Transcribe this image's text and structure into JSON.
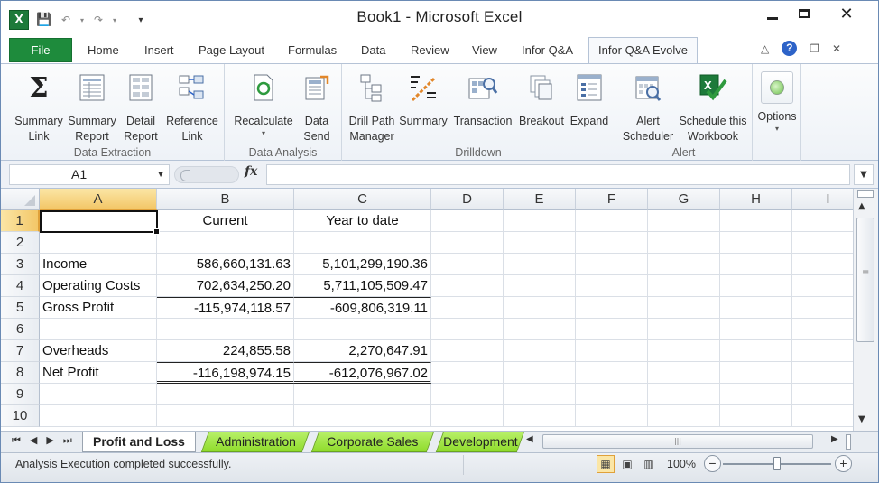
{
  "window": {
    "title": "Book1  -  Microsoft Excel",
    "app_icon_letter": "X"
  },
  "ribbon_tabs": [
    "File",
    "Home",
    "Insert",
    "Page Layout",
    "Formulas",
    "Data",
    "Review",
    "View",
    "Infor Q&A",
    "Infor Q&A Evolve"
  ],
  "active_tab": "Infor Q&A Evolve",
  "ribbon_groups": [
    {
      "label": "Data Extraction",
      "buttons": [
        {
          "line1": "Summary",
          "line2": "Link",
          "icon": "sigma-icon"
        },
        {
          "line1": "Summary",
          "line2": "Report",
          "icon": "summary-report-icon"
        },
        {
          "line1": "Detail",
          "line2": "Report",
          "icon": "detail-report-icon"
        },
        {
          "line1": "Reference",
          "line2": "Link",
          "icon": "reference-link-icon"
        }
      ]
    },
    {
      "label": "Data Analysis",
      "buttons": [
        {
          "line1": "Recalculate",
          "line2": "",
          "icon": "recalculate-icon"
        },
        {
          "line1": "Data",
          "line2": "Send",
          "icon": "data-send-icon"
        }
      ]
    },
    {
      "label": "Drilldown",
      "buttons": [
        {
          "line1": "Drill Path",
          "line2": "Manager",
          "icon": "drill-path-icon"
        },
        {
          "line1": "Summary",
          "line2": "",
          "icon": "drill-summary-icon"
        },
        {
          "line1": "Transaction",
          "line2": "",
          "icon": "transaction-icon"
        },
        {
          "line1": "Breakout",
          "line2": "",
          "icon": "breakout-icon"
        },
        {
          "line1": "Expand",
          "line2": "",
          "icon": "expand-icon"
        }
      ]
    },
    {
      "label": "Alert",
      "buttons": [
        {
          "line1": "Alert",
          "line2": "Scheduler",
          "icon": "alert-scheduler-icon"
        },
        {
          "line1": "Schedule this",
          "line2": "Workbook",
          "icon": "schedule-workbook-icon"
        }
      ]
    },
    {
      "label": "",
      "buttons": [
        {
          "line1": "Options",
          "line2": "",
          "icon": "options-icon"
        }
      ]
    }
  ],
  "formula_bar": {
    "name_box": "A1",
    "fx": "fx",
    "formula": ""
  },
  "columns": [
    "A",
    "B",
    "C",
    "D",
    "E",
    "F",
    "G",
    "H",
    "I"
  ],
  "rows": [
    "1",
    "2",
    "3",
    "4",
    "5",
    "6",
    "7",
    "8",
    "9",
    "10"
  ],
  "cells": {
    "B1": "Current",
    "C1": "Year to date",
    "A3": "Income",
    "B3": "586,660,131.63",
    "C3": "5,101,299,190.36",
    "A4": "Operating Costs",
    "B4": "702,634,250.20",
    "C4": "5,711,105,509.47",
    "A5": "Gross Profit",
    "B5": "-115,974,118.57",
    "C5": "-609,806,319.11",
    "A7": "Overheads",
    "B7": "224,855.58",
    "C7": "2,270,647.91",
    "A8": "Net Profit",
    "B8": "-116,198,974.15",
    "C8": "-612,076,967.02"
  },
  "sheets": [
    "Profit and Loss",
    "Administration",
    "Corporate Sales",
    "Development"
  ],
  "active_sheet": "Profit and Loss",
  "status": {
    "message": "Analysis Execution completed successfully.",
    "zoom": "100%"
  },
  "colors": {
    "file_tab": "#1e8b3c",
    "sheet_tab_green": "#8fdc2c",
    "selection_highlight": "#f3c768"
  }
}
